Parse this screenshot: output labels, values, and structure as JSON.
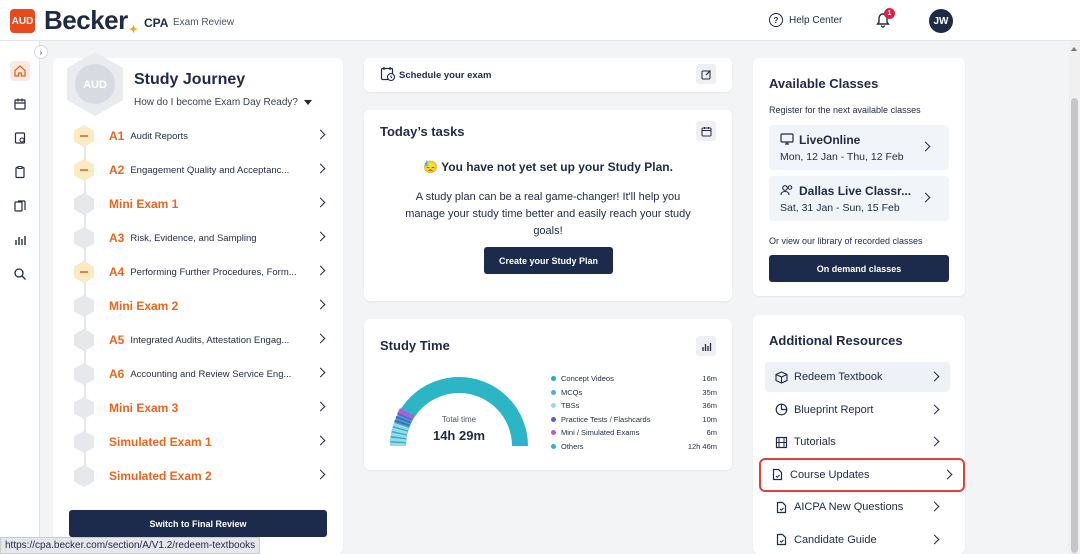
{
  "header": {
    "badge": "AUD",
    "brand": "Becker",
    "product": "CPA",
    "product_sub": "Exam Review",
    "help": "Help Center",
    "notifications": "1",
    "avatar": "JW"
  },
  "rail": {
    "items": [
      "home-icon",
      "calendar-icon",
      "assignment-icon",
      "clipboard-icon",
      "flashcards-icon",
      "chart-icon",
      "search-icon"
    ]
  },
  "journey": {
    "badge": "AUD",
    "title": "Study Journey",
    "subtitle": "How do I become Exam Day Ready?",
    "rows": [
      {
        "code": "A1",
        "title": "Audit Reports",
        "status": "in-progress"
      },
      {
        "code": "A2",
        "title": "Engagement Quality and Acceptanc...",
        "status": "in-progress"
      },
      {
        "code": "",
        "title": "Mini Exam 1",
        "status": "locked"
      },
      {
        "code": "A3",
        "title": "Risk, Evidence, and Sampling",
        "status": "locked"
      },
      {
        "code": "A4",
        "title": "Performing Further Procedures, Form...",
        "status": "in-progress"
      },
      {
        "code": "",
        "title": "Mini Exam 2",
        "status": "locked"
      },
      {
        "code": "A5",
        "title": "Integrated Audits, Attestation Engag...",
        "status": "locked"
      },
      {
        "code": "A6",
        "title": "Accounting and Review Service Eng...",
        "status": "locked"
      },
      {
        "code": "",
        "title": "Mini Exam 3",
        "status": "locked"
      },
      {
        "code": "",
        "title": "Simulated Exam 1",
        "status": "locked"
      },
      {
        "code": "",
        "title": "Simulated Exam 2",
        "status": "locked"
      }
    ],
    "switch_btn": "Switch to Final Review"
  },
  "status_url": "https://cpa.becker.com/section/A/V1.2/redeem-textbooks",
  "schedule": {
    "label": "Schedule your exam"
  },
  "tasks": {
    "title": "Today’s tasks",
    "emoji": "😓",
    "headline": "You have not yet set up your Study Plan.",
    "body": "A study plan can be a real game-changer! It'll help you manage your study time better and easily reach your study goals!",
    "button": "Create your Study Plan"
  },
  "study_time": {
    "title": "Study Time",
    "total_label": "Total time",
    "total_value": "14h 29m",
    "legend": [
      {
        "name": "Concept Videos",
        "value": "16m",
        "color": "#2aa9c9"
      },
      {
        "name": "MCQs",
        "value": "35m",
        "color": "#3bb9d6"
      },
      {
        "name": "TBSs",
        "value": "36m",
        "color": "#9ed6ea"
      },
      {
        "name": "Practice Tests / Flashcards",
        "value": "10m",
        "color": "#5b5fc7"
      },
      {
        "name": "Mini / Simulated Exams",
        "value": "6m",
        "color": "#b05cd6"
      },
      {
        "name": "Others",
        "value": "12h 46m",
        "color": "#2bb5c5"
      }
    ]
  },
  "available": {
    "title": "Available Classes",
    "subtitle": "Register for the next available classes",
    "classes": [
      {
        "name": "LiveOnline",
        "dates": "Mon, 12 Jan - Thu, 12 Feb"
      },
      {
        "name": "Dallas Live Classr...",
        "dates": "Sat, 31 Jan - Sun, 15 Feb"
      }
    ],
    "or_text": "Or view our library of recorded classes",
    "ondemand_btn": "On demand classes"
  },
  "resources": {
    "title": "Additional Resources",
    "items": [
      {
        "label": "Redeem Textbook",
        "icon": "box-icon"
      },
      {
        "label": "Blueprint Report",
        "icon": "pie-chart-icon"
      },
      {
        "label": "Tutorials",
        "icon": "film-icon"
      },
      {
        "label": "Course Updates",
        "icon": "document-icon"
      },
      {
        "label": "AICPA New Questions",
        "icon": "document-icon"
      },
      {
        "label": "Candidate Guide",
        "icon": "document-icon"
      }
    ]
  }
}
